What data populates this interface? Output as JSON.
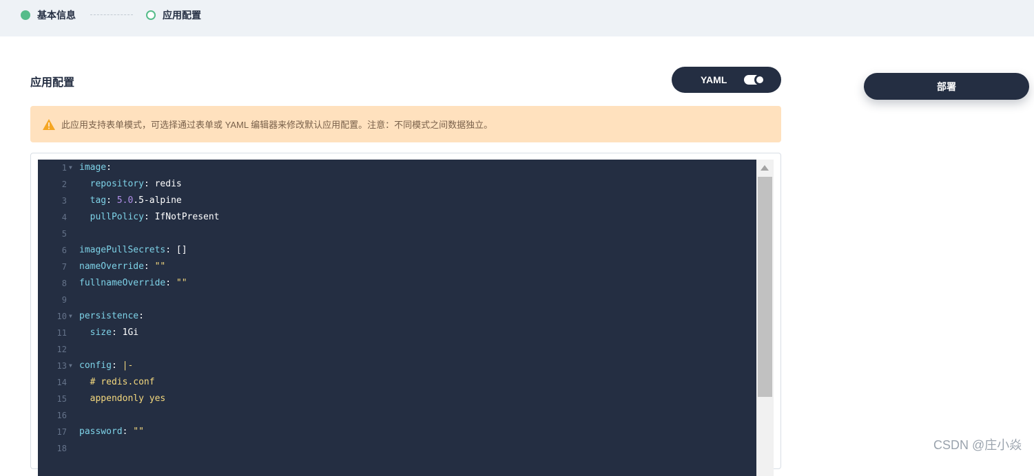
{
  "steps": [
    {
      "label": "基本信息",
      "state": "done"
    },
    {
      "label": "应用配置",
      "state": "active"
    }
  ],
  "section_title": "应用配置",
  "yaml_toggle": {
    "label": "YAML",
    "on": true
  },
  "deploy_button": "部署",
  "notice": "此应用支持表单模式，可选择通过表单或 YAML 编辑器来修改默认应用配置。注意：不同模式之间数据独立。",
  "editor": {
    "lines": [
      {
        "n": "1",
        "fold": true,
        "tokens": [
          [
            "k",
            "image"
          ],
          [
            "p",
            ":"
          ]
        ]
      },
      {
        "n": "2",
        "fold": false,
        "tokens": [
          [
            "p",
            "  "
          ],
          [
            "k",
            "repository"
          ],
          [
            "p",
            ": "
          ],
          [
            "v",
            "redis"
          ]
        ]
      },
      {
        "n": "3",
        "fold": false,
        "tokens": [
          [
            "p",
            "  "
          ],
          [
            "k",
            "tag"
          ],
          [
            "p",
            ": "
          ],
          [
            "n",
            "5.0"
          ],
          [
            "v",
            ".5-alpine"
          ]
        ]
      },
      {
        "n": "4",
        "fold": false,
        "tokens": [
          [
            "p",
            "  "
          ],
          [
            "k",
            "pullPolicy"
          ],
          [
            "p",
            ": "
          ],
          [
            "v",
            "IfNotPresent"
          ]
        ]
      },
      {
        "n": "5",
        "fold": false,
        "tokens": []
      },
      {
        "n": "6",
        "fold": false,
        "tokens": [
          [
            "k",
            "imagePullSecrets"
          ],
          [
            "p",
            ": "
          ],
          [
            "v",
            "[]"
          ]
        ]
      },
      {
        "n": "7",
        "fold": false,
        "tokens": [
          [
            "k",
            "nameOverride"
          ],
          [
            "p",
            ": "
          ],
          [
            "s",
            "\"\""
          ]
        ]
      },
      {
        "n": "8",
        "fold": false,
        "tokens": [
          [
            "k",
            "fullnameOverride"
          ],
          [
            "p",
            ": "
          ],
          [
            "s",
            "\"\""
          ]
        ]
      },
      {
        "n": "9",
        "fold": false,
        "tokens": []
      },
      {
        "n": "10",
        "fold": true,
        "tokens": [
          [
            "k",
            "persistence"
          ],
          [
            "p",
            ":"
          ]
        ]
      },
      {
        "n": "11",
        "fold": false,
        "tokens": [
          [
            "p",
            "  "
          ],
          [
            "k",
            "size"
          ],
          [
            "p",
            ": "
          ],
          [
            "v",
            "1Gi"
          ]
        ]
      },
      {
        "n": "12",
        "fold": false,
        "tokens": []
      },
      {
        "n": "13",
        "fold": true,
        "tokens": [
          [
            "k",
            "config"
          ],
          [
            "p",
            ": "
          ],
          [
            "s",
            "|-"
          ]
        ]
      },
      {
        "n": "14",
        "fold": false,
        "tokens": [
          [
            "p",
            "  "
          ],
          [
            "c",
            "# redis.conf"
          ]
        ]
      },
      {
        "n": "15",
        "fold": false,
        "tokens": [
          [
            "p",
            "  "
          ],
          [
            "c",
            "appendonly yes"
          ]
        ]
      },
      {
        "n": "16",
        "fold": false,
        "tokens": []
      },
      {
        "n": "17",
        "fold": false,
        "tokens": [
          [
            "k",
            "password"
          ],
          [
            "p",
            ": "
          ],
          [
            "s",
            "\"\""
          ]
        ]
      },
      {
        "n": "18",
        "fold": false,
        "tokens": []
      }
    ]
  },
  "watermark": "CSDN @庄小焱",
  "colors": {
    "dark": "#242e42",
    "step_green": "#55bc8a",
    "notice_bg": "#ffe1be",
    "key": "#7ed3e8",
    "string": "#f5d97e",
    "number": "#b18fe9"
  }
}
